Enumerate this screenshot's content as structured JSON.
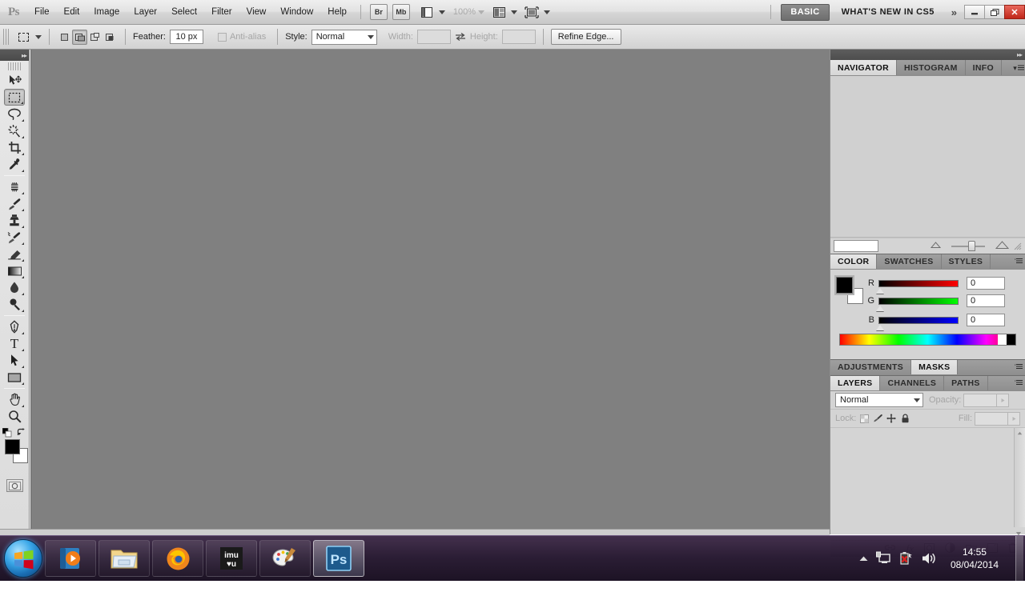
{
  "app": {
    "logo": "Ps",
    "title": "Adobe Photoshop CS5"
  },
  "menubar": {
    "items": [
      {
        "label": "File"
      },
      {
        "label": "Edit"
      },
      {
        "label": "Image"
      },
      {
        "label": "Layer"
      },
      {
        "label": "Select"
      },
      {
        "label": "Filter"
      },
      {
        "label": "View"
      },
      {
        "label": "Window"
      },
      {
        "label": "Help"
      }
    ],
    "bridge_button": "Br",
    "minibridge_button": "Mb",
    "view_extras_icon": "view-extras-icon",
    "zoom_level": "100%",
    "arrange_documents_icon": "arrange-documents-icon",
    "screen_mode_icon": "screen-mode-icon",
    "workspace_active": "BASIC",
    "workspace_whats_new": "WHAT'S NEW IN CS5",
    "overflow_chevrons": "»",
    "window_controls": {
      "minimize": "–",
      "restore": "❐",
      "close": "✕"
    }
  },
  "optionsbar": {
    "tool_icon": "rectangular-marquee-icon",
    "tool_preset_caret": "▾",
    "selection_modes": [
      {
        "name": "new-selection",
        "selected": false
      },
      {
        "name": "add-to-selection",
        "selected": true
      },
      {
        "name": "subtract-from-selection",
        "selected": false
      },
      {
        "name": "intersect-with-selection",
        "selected": false
      }
    ],
    "feather_label": "Feather:",
    "feather_value": "10 px",
    "antialias_label": "Anti-alias",
    "antialias_checked": false,
    "style_label": "Style:",
    "style_value": "Normal",
    "width_label": "Width:",
    "width_value": "",
    "swap_icon": "swap-width-height-icon",
    "height_label": "Height:",
    "height_value": "",
    "refine_edge_button": "Refine Edge..."
  },
  "toolbox": {
    "collapse_icon": "collapse-panel-icon",
    "tools": [
      {
        "name": "move-tool",
        "glyph": "move",
        "selected": false,
        "has_flyout": false
      },
      {
        "name": "rectangular-marquee-tool",
        "glyph": "marquee",
        "selected": true,
        "has_flyout": true
      },
      {
        "name": "lasso-tool",
        "glyph": "lasso",
        "selected": false,
        "has_flyout": true
      },
      {
        "name": "quick-selection-tool",
        "glyph": "quickselect",
        "selected": false,
        "has_flyout": true
      },
      {
        "name": "crop-tool",
        "glyph": "crop",
        "selected": false,
        "has_flyout": true
      },
      {
        "name": "eyedropper-tool",
        "glyph": "eyedropper",
        "selected": false,
        "has_flyout": true
      },
      {
        "name": "spot-healing-brush-tool",
        "glyph": "healing",
        "selected": false,
        "has_flyout": true
      },
      {
        "name": "brush-tool",
        "glyph": "brush",
        "selected": false,
        "has_flyout": true
      },
      {
        "name": "clone-stamp-tool",
        "glyph": "stamp",
        "selected": false,
        "has_flyout": true
      },
      {
        "name": "history-brush-tool",
        "glyph": "historybrush",
        "selected": false,
        "has_flyout": true
      },
      {
        "name": "eraser-tool",
        "glyph": "eraser",
        "selected": false,
        "has_flyout": true
      },
      {
        "name": "gradient-tool",
        "glyph": "gradient",
        "selected": false,
        "has_flyout": true
      },
      {
        "name": "blur-tool",
        "glyph": "blur",
        "selected": false,
        "has_flyout": true
      },
      {
        "name": "dodge-tool",
        "glyph": "dodge",
        "selected": false,
        "has_flyout": true
      },
      {
        "name": "pen-tool",
        "glyph": "pen",
        "selected": false,
        "has_flyout": true
      },
      {
        "name": "horizontal-type-tool",
        "glyph": "type",
        "selected": false,
        "has_flyout": true
      },
      {
        "name": "path-selection-tool",
        "glyph": "pathselect",
        "selected": false,
        "has_flyout": true
      },
      {
        "name": "rectangle-tool",
        "glyph": "shape",
        "selected": false,
        "has_flyout": true
      },
      {
        "name": "hand-tool",
        "glyph": "hand",
        "selected": false,
        "has_flyout": true
      },
      {
        "name": "zoom-tool",
        "glyph": "zoom",
        "selected": false,
        "has_flyout": false
      }
    ],
    "foreground_color": "#000000",
    "background_color": "#ffffff",
    "default_colors_icon": "default-colors-icon",
    "swap_colors_icon": "swap-colors-icon",
    "quick_mask_icon": "quick-mask-icon"
  },
  "canvas": {
    "background_color": "#808080"
  },
  "dock": {
    "collapse_icon": "collapse-dock-icon",
    "navigator_group": {
      "tabs": [
        {
          "label": "NAVIGATOR",
          "active": true
        },
        {
          "label": "HISTOGRAM",
          "active": false
        },
        {
          "label": "INFO",
          "active": false
        }
      ],
      "zoom_field_value": "",
      "zoom_out_icon": "zoom-out-icon",
      "zoom_in_icon": "zoom-in-icon",
      "resize_grip_icon": "resize-grip-icon",
      "panel_menu_icon": "panel-menu-icon"
    },
    "color_group": {
      "tabs": [
        {
          "label": "COLOR",
          "active": true
        },
        {
          "label": "SWATCHES",
          "active": false
        },
        {
          "label": "STYLES",
          "active": false
        }
      ],
      "foreground_color": "#000000",
      "background_color": "#ffffff",
      "channels": [
        {
          "label": "R",
          "value": "0"
        },
        {
          "label": "G",
          "value": "0"
        },
        {
          "label": "B",
          "value": "0"
        }
      ],
      "panel_menu_icon": "panel-menu-icon"
    },
    "adjustments_group": {
      "tabs": [
        {
          "label": "ADJUSTMENTS",
          "active": false
        },
        {
          "label": "MASKS",
          "active": true
        }
      ],
      "panel_menu_icon": "panel-menu-icon"
    },
    "layers_group": {
      "tabs": [
        {
          "label": "LAYERS",
          "active": true
        },
        {
          "label": "CHANNELS",
          "active": false
        },
        {
          "label": "PATHS",
          "active": false
        }
      ],
      "blend_mode": "Normal",
      "opacity_label": "Opacity:",
      "opacity_value": "",
      "lock_label": "Lock:",
      "lock_icons": [
        {
          "name": "lock-transparent-pixels-icon"
        },
        {
          "name": "lock-image-pixels-icon"
        },
        {
          "name": "lock-position-icon"
        },
        {
          "name": "lock-all-icon"
        }
      ],
      "fill_label": "Fill:",
      "fill_value": "",
      "footer_icons": [
        {
          "name": "link-layers-icon"
        },
        {
          "name": "layer-styles-fx-icon"
        },
        {
          "name": "add-layer-mask-icon"
        },
        {
          "name": "new-adjustment-layer-icon"
        },
        {
          "name": "new-group-icon"
        },
        {
          "name": "new-layer-icon"
        },
        {
          "name": "delete-layer-icon"
        }
      ],
      "panel_menu_icon": "panel-menu-icon"
    }
  },
  "taskbar": {
    "start_button": "start-orb-icon",
    "items": [
      {
        "name": "taskbar-windows-media-player",
        "label": "Windows Media Player",
        "active": false
      },
      {
        "name": "taskbar-windows-explorer",
        "label": "Windows Explorer",
        "active": false
      },
      {
        "name": "taskbar-firefox",
        "label": "Mozilla Firefox",
        "active": false
      },
      {
        "name": "taskbar-imvu",
        "label": "IMVU",
        "active": false
      },
      {
        "name": "taskbar-paint",
        "label": "Paint",
        "active": false
      },
      {
        "name": "taskbar-photoshop",
        "label": "Adobe Photoshop CS5",
        "active": true
      }
    ],
    "tray": {
      "show_hidden_icon": "show-hidden-icons-arrow",
      "network_icon": "network-icon",
      "battery_icon": "battery-error-icon",
      "volume_icon": "volume-icon",
      "time": "14:55",
      "date": "08/04/2014",
      "show_desktop": "show-desktop-button"
    }
  }
}
